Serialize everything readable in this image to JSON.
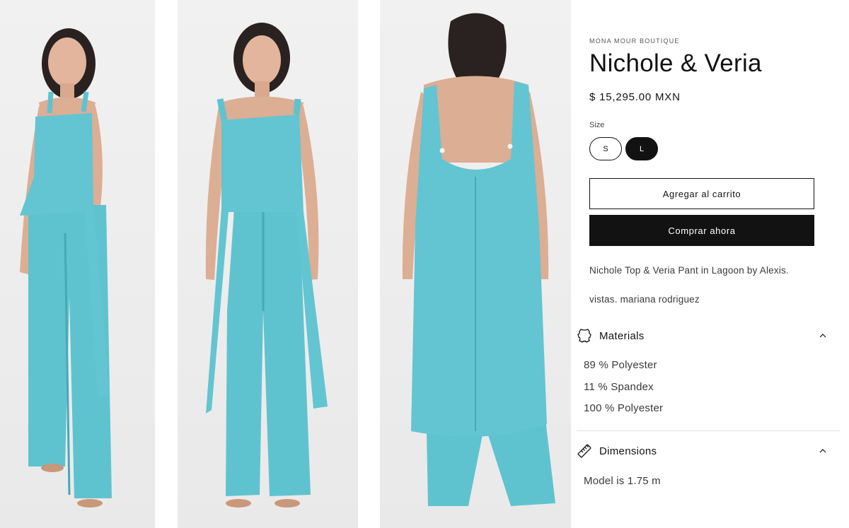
{
  "gallery": [
    {
      "name": "front-three-quarter-view"
    },
    {
      "name": "front-view"
    },
    {
      "name": "back-view"
    }
  ],
  "product": {
    "vendor": "MONA MOUR BOUTIQUE",
    "title": "Nichole & Veria",
    "price": "$ 15,295.00 MXN",
    "size_label": "Size",
    "sizes": [
      "S",
      "L"
    ],
    "selected_size": "L",
    "add_to_cart_label": "Agregar al carrito",
    "buy_now_label": "Comprar ahora",
    "description_line1": "Nichole Top & Veria Pant in Lagoon by Alexis.",
    "description_line2": "vistas. mariana rodriguez"
  },
  "accordions": {
    "materials": {
      "title": "Materials",
      "icon": "leather-hide-icon",
      "lines": [
        "89 % Polyester",
        "11 % Spandex",
        "100 % Polyester"
      ]
    },
    "dimensions": {
      "title": "Dimensions",
      "icon": "ruler-icon",
      "lines": [
        "Model is 1.75 m"
      ]
    }
  },
  "colors": {
    "garment": "#5fc3cf",
    "garment_shadow": "#46a9b6",
    "primary": "#121212",
    "background": "#ffffff"
  }
}
